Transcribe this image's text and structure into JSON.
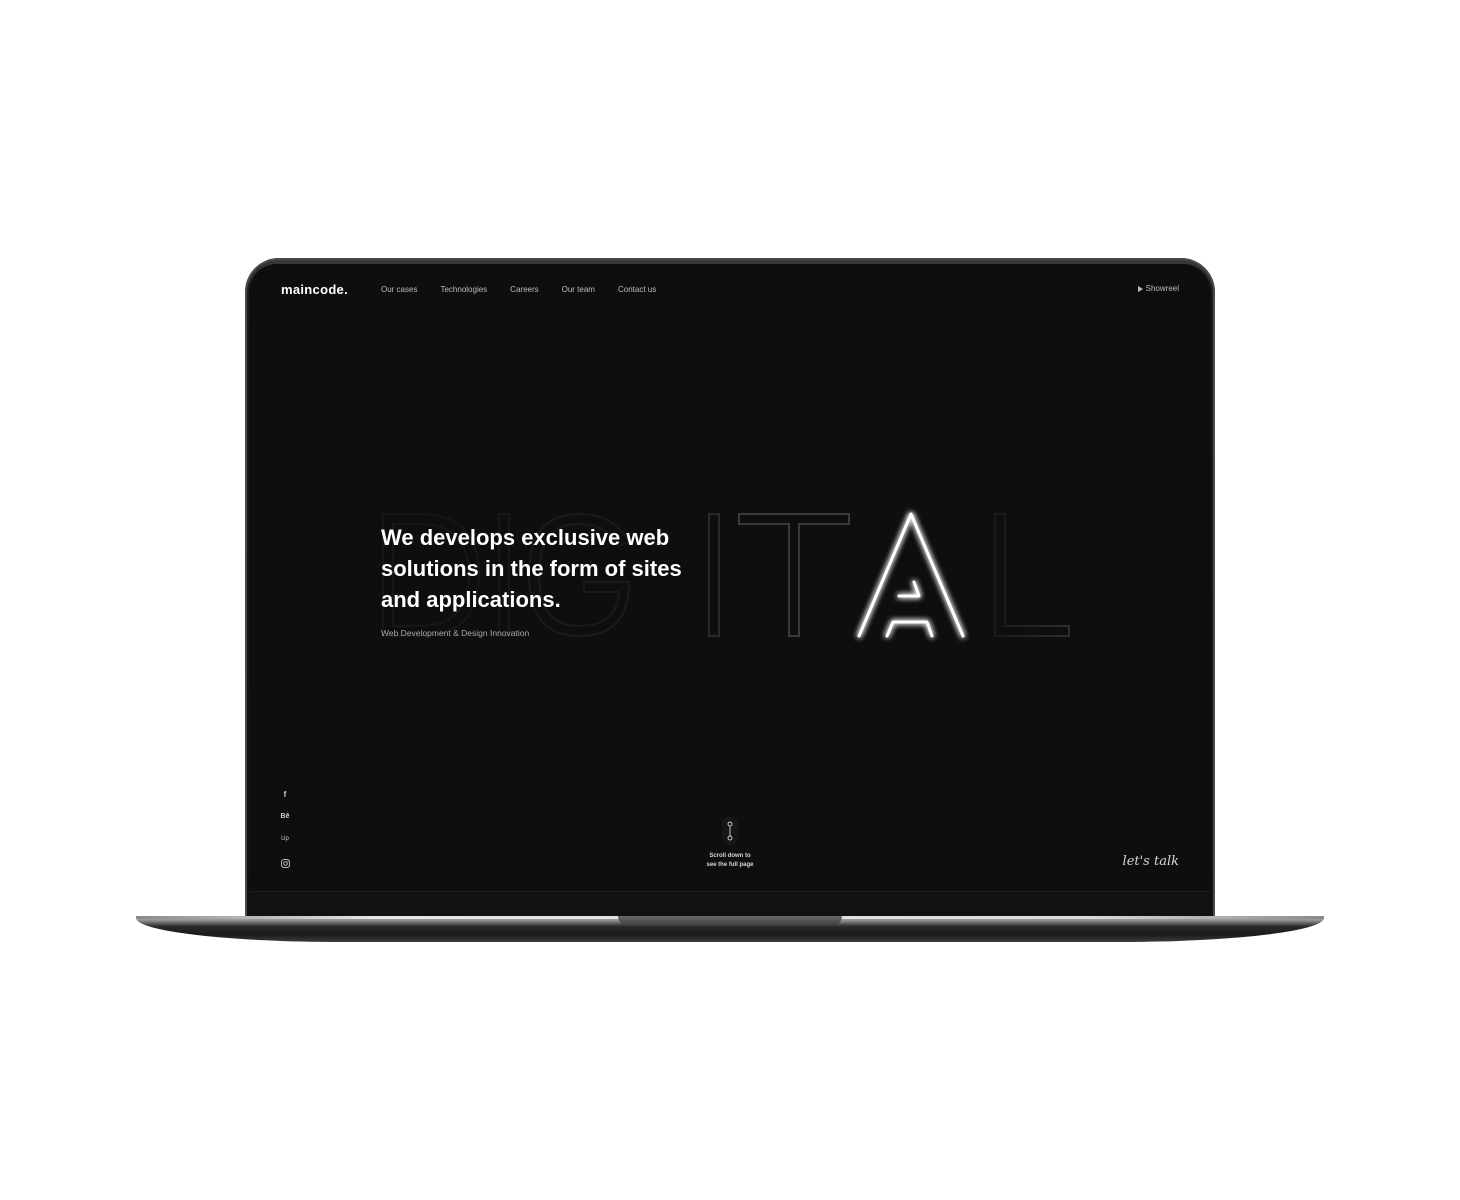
{
  "header": {
    "logo": "maincode.",
    "nav": [
      {
        "label": "Our cases"
      },
      {
        "label": "Technologies"
      },
      {
        "label": "Careers"
      },
      {
        "label": "Our team"
      },
      {
        "label": "Contact us"
      }
    ],
    "showreel_label": "Showreel"
  },
  "hero": {
    "background_word": "DIGITAL",
    "headline_lines": [
      "We develops exclusive web",
      "solutions in the form of sites",
      "and applications."
    ],
    "subline": "Web Development & Design Innovation"
  },
  "social": [
    {
      "icon": "facebook-icon",
      "glyph": "f"
    },
    {
      "icon": "behance-icon",
      "glyph": "Bē"
    },
    {
      "icon": "upwork-icon",
      "glyph": "Up"
    },
    {
      "icon": "instagram-icon",
      "glyph": ""
    }
  ],
  "scroll_hint": {
    "line1": "Scroll down to",
    "line2": "see the full page"
  },
  "cta": {
    "lets_talk": "let's talk"
  },
  "colors": {
    "screen_bg": "#0e0e0e",
    "text": "#ffffff",
    "muted": "#a9a9a9",
    "glow": "#ffffff"
  }
}
